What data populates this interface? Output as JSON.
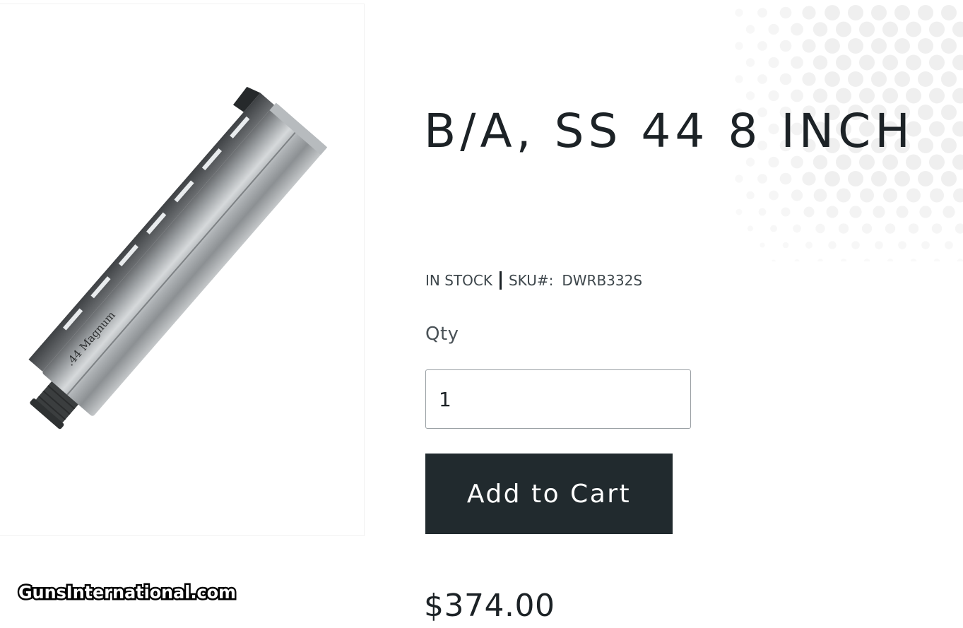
{
  "product": {
    "title": "B/A, SS 44 8 INCH",
    "stock_status": "IN STOCK",
    "sku_label": "SKU#:",
    "sku_value": "DWRB332S",
    "price": "$374.00"
  },
  "image": {
    "alt": ".44 Magnum",
    "barrel_marking": ".44 Magnum"
  },
  "watermark": {
    "text": "GunsInternational.com"
  },
  "form": {
    "qty_label": "Qty",
    "qty_value": "1",
    "add_to_cart_label": "Add to Cart"
  },
  "colors": {
    "text": "#1c2226",
    "button_bg": "#212a2e",
    "button_text": "#ffffff",
    "dots": "#efefef"
  }
}
